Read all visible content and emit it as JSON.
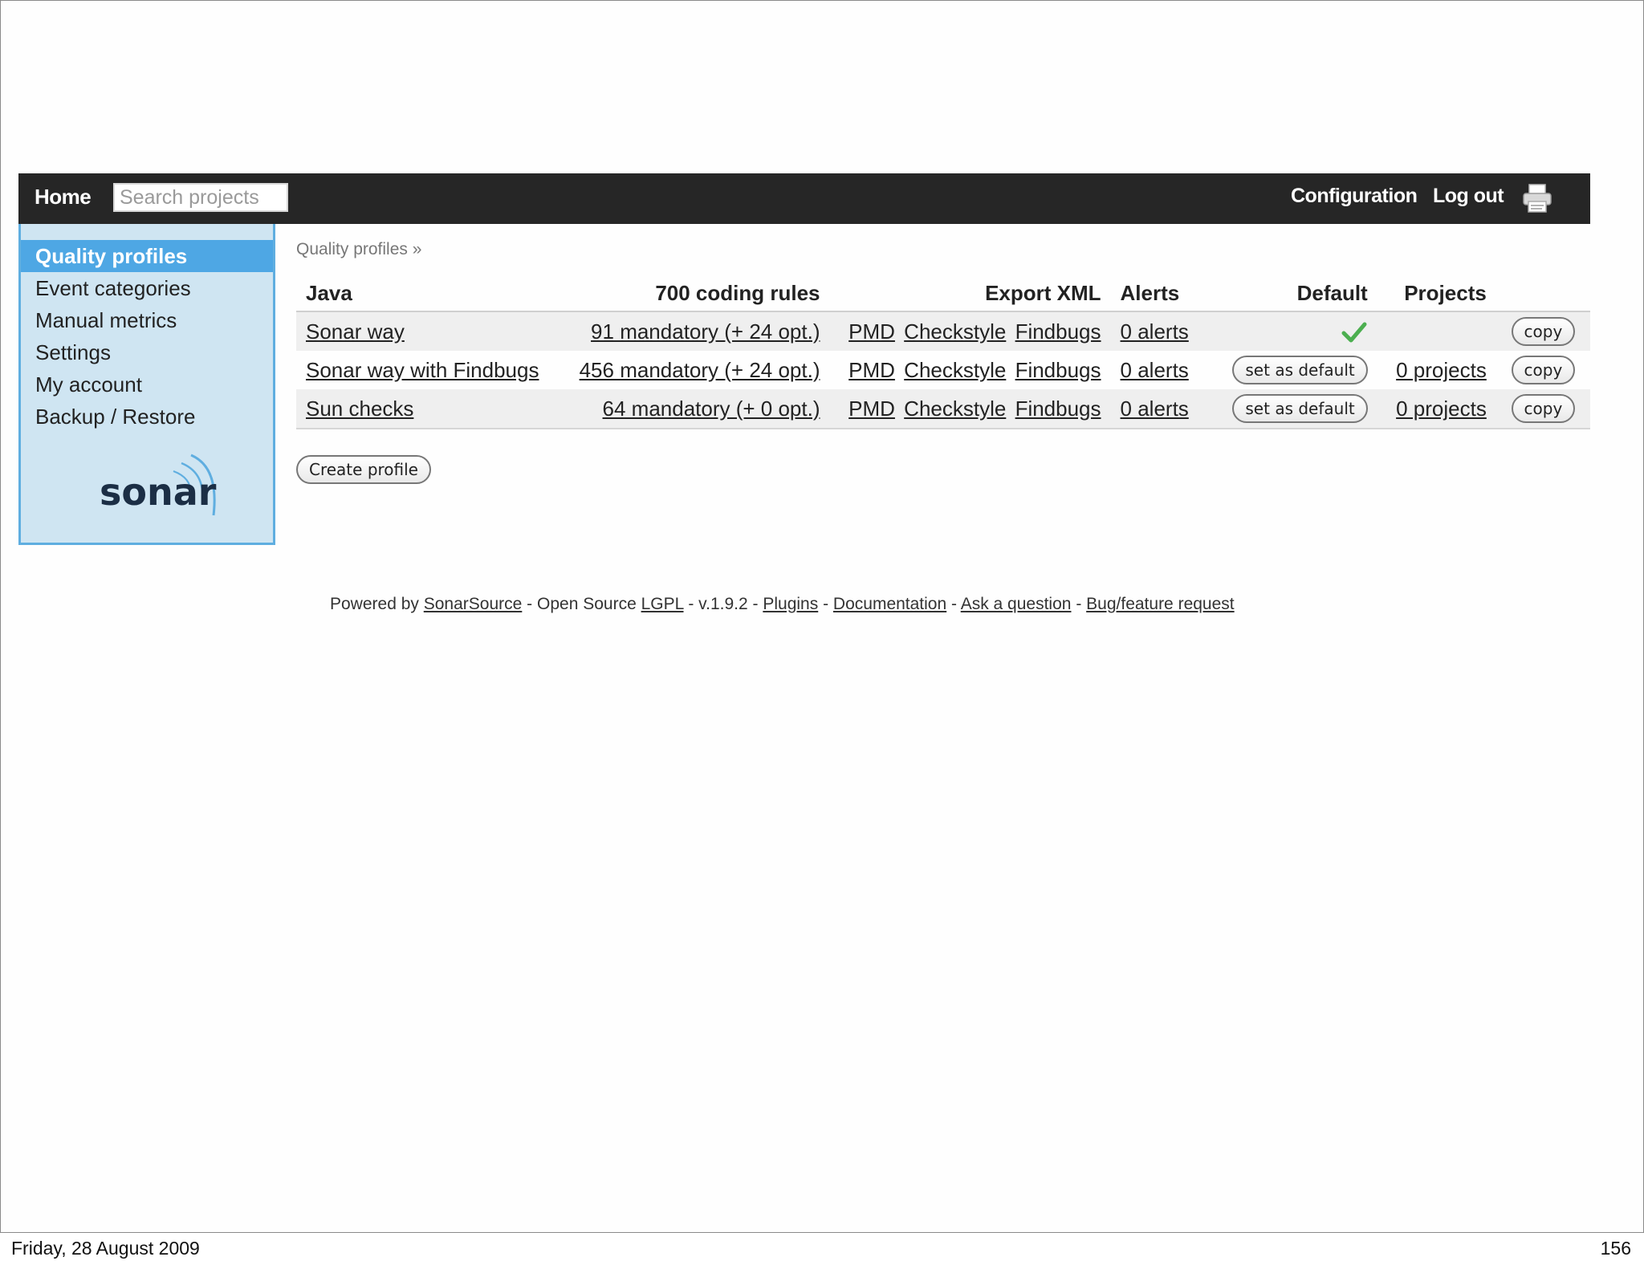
{
  "header": {
    "home_label": "Home",
    "search_placeholder": "Search projects",
    "configuration_label": "Configuration",
    "logout_label": "Log out",
    "print_icon": "printer-icon"
  },
  "sidebar": {
    "items": [
      {
        "label": "Quality profiles",
        "active": true
      },
      {
        "label": "Event categories"
      },
      {
        "label": "Manual metrics"
      },
      {
        "label": "Settings"
      },
      {
        "label": "My account"
      },
      {
        "label": "Backup / Restore"
      }
    ],
    "logo_text": "sonar"
  },
  "breadcrumb": "Quality profiles »",
  "table": {
    "headers": {
      "language": "Java",
      "rules": "700 coding rules",
      "export": "Export XML",
      "alerts": "Alerts",
      "default": "Default",
      "projects": "Projects"
    },
    "rows": [
      {
        "name": "Sonar way",
        "rules": "91 mandatory (+ 24 opt.)",
        "export": [
          "PMD",
          "Checkstyle",
          "Findbugs"
        ],
        "alerts": "0 alerts",
        "is_default": true,
        "projects": "",
        "copy": "copy"
      },
      {
        "name": "Sonar way with Findbugs",
        "rules": "456 mandatory (+ 24 opt.)",
        "export": [
          "PMD",
          "Checkstyle",
          "Findbugs"
        ],
        "alerts": "0 alerts",
        "default_button": "set as default",
        "projects": "0 projects",
        "copy": "copy"
      },
      {
        "name": "Sun checks",
        "rules": "64 mandatory (+ 0 opt.)",
        "export": [
          "PMD",
          "Checkstyle",
          "Findbugs"
        ],
        "alerts": "0 alerts",
        "default_button": "set as default",
        "projects": "0 projects",
        "copy": "copy"
      }
    ]
  },
  "create_profile_label": "Create profile",
  "footer": {
    "powered_by": "Powered by",
    "sonarsource": "SonarSource",
    "open_source": "- Open Source",
    "lgpl": "LGPL",
    "version": "- v.1.9.2 -",
    "plugins": "Plugins",
    "documentation": "Documentation",
    "ask": "Ask a question",
    "bug": "Bug/feature request",
    "sep": "-"
  },
  "slide_footer": {
    "date": "Friday, 28 August 2009",
    "page": "156"
  },
  "colors": {
    "topbar": "#262626",
    "sidebar_bg": "#cfe5f2",
    "sidebar_active": "#4ea7e4",
    "check": "#4caf50"
  }
}
